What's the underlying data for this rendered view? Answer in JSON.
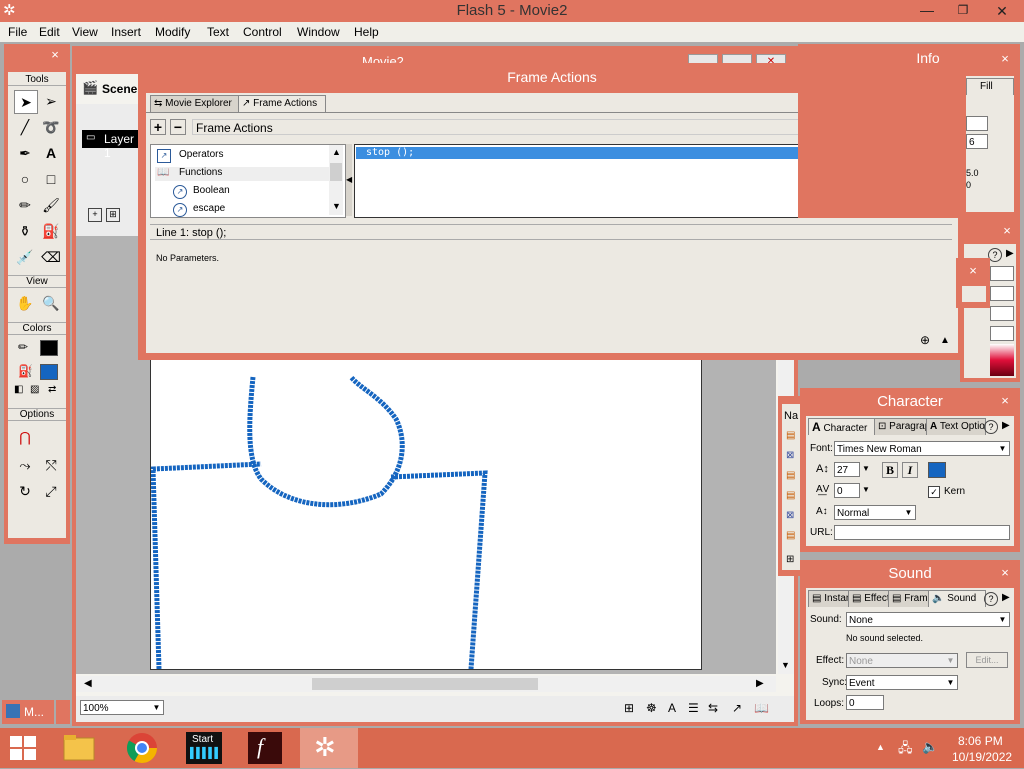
{
  "app": {
    "title": "Flash 5 - Movie2"
  },
  "menu": [
    "File",
    "Edit",
    "View",
    "Insert",
    "Modify",
    "Text",
    "Control",
    "Window",
    "Help"
  ],
  "movie": {
    "title": "Movie2",
    "scene_label": "Scene 1",
    "layer_label": "Layer 1",
    "zoom": "100%",
    "minimized_label": "M..."
  },
  "tools": {
    "title": "Tools",
    "view_label": "View",
    "colors_label": "Colors",
    "options_label": "Options",
    "stroke_color": "#000000",
    "fill_color": "#1565c0"
  },
  "frame_actions": {
    "title": "Frame Actions",
    "tabs": [
      "Movie Explorer",
      "Frame Actions"
    ],
    "header_label": "Frame Actions",
    "tree": [
      "Operators",
      "Functions",
      "Boolean",
      "escape"
    ],
    "code": "stop ();",
    "status_line": "Line 1: stop ();",
    "params_text": "No Parameters."
  },
  "info": {
    "title": "Info",
    "fill_tab": "Fill",
    "val1": "6",
    "val2": "5.0",
    "val3": "0"
  },
  "library": {
    "header": "Na"
  },
  "character": {
    "title": "Character",
    "tabs": [
      "Character",
      "Paragraph",
      "Text Options"
    ],
    "font_label": "Font:",
    "font_value": "Times New Roman",
    "size_value": "27",
    "tracking_value": "0",
    "baseline_value": "Normal",
    "bold": "B",
    "italic": "I",
    "kern_label": "Kern",
    "url_label": "URL:",
    "text_color": "#1565c0"
  },
  "sound": {
    "title": "Sound",
    "tabs": [
      "Instance",
      "Effect",
      "Frame",
      "Sound"
    ],
    "sound_label": "Sound:",
    "sound_value": "None",
    "info_text": "No sound selected.",
    "effect_label": "Effect:",
    "effect_value": "None",
    "edit_label": "Edit...",
    "sync_label": "Sync:",
    "sync_value": "Event",
    "loops_label": "Loops:",
    "loops_value": "0"
  },
  "taskbar": {
    "time": "8:06 PM",
    "date": "10/19/2022",
    "start_app_label": "Start"
  }
}
